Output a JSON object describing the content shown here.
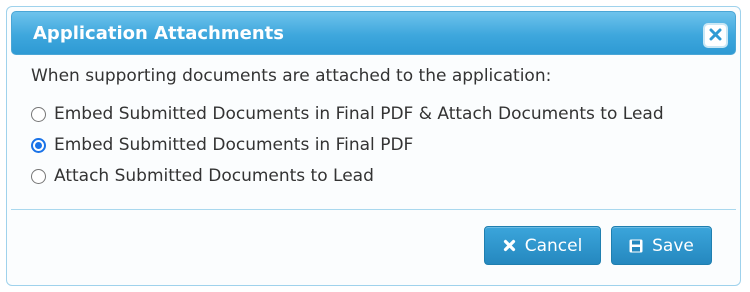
{
  "dialog": {
    "title": "Application Attachments",
    "close_icon": "close-icon",
    "prompt": "When supporting documents are attached to the application:",
    "options": [
      {
        "label": "Embed Submitted Documents in Final PDF & Attach Documents to Lead",
        "selected": false
      },
      {
        "label": "Embed Submitted Documents in Final PDF",
        "selected": true
      },
      {
        "label": "Attach Submitted Documents to Lead",
        "selected": false
      }
    ],
    "buttons": {
      "cancel_label": "Cancel",
      "cancel_icon": "close-icon",
      "save_label": "Save",
      "save_icon": "floppy-disk-icon"
    }
  },
  "colors": {
    "titlebar": "#3ea7dd",
    "button": "#2588bf",
    "radio_selected": "#1a73e8"
  }
}
